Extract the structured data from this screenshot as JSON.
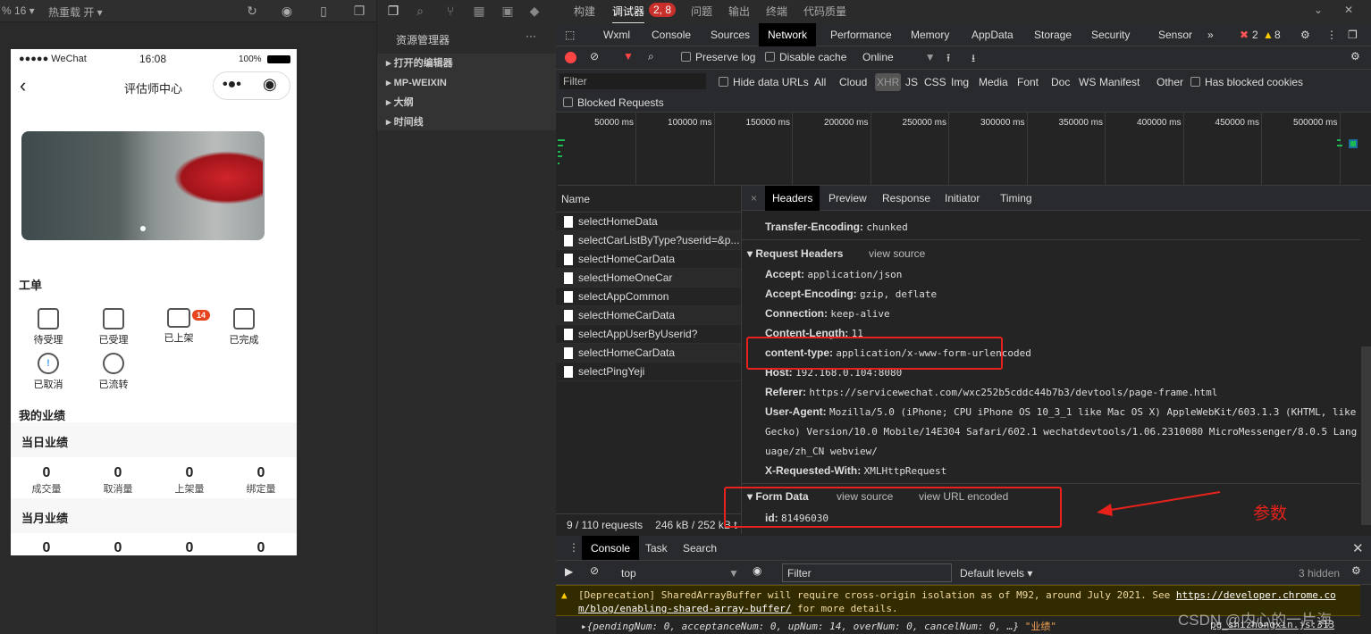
{
  "simulator": {
    "zoom": "% 16 ▾",
    "hot_reload": "热重载 开 ▾"
  },
  "phone": {
    "status": {
      "carrier": "●●●●● WeChat",
      "time": "16:08",
      "battery": "100%"
    },
    "nav_title": "评估师中心",
    "capsule_more": "•●•",
    "capsule_close": "◉",
    "orders_title": "工单",
    "orders": [
      {
        "label": "待受理"
      },
      {
        "label": "已受理"
      },
      {
        "label": "已上架",
        "badge": "14"
      },
      {
        "label": "已完成"
      },
      {
        "label": "已取消"
      },
      {
        "label": "已流转"
      }
    ],
    "perf_title": "我的业绩",
    "daily": {
      "title": "当日业绩",
      "stats": [
        {
          "value": "0",
          "label": "成交量"
        },
        {
          "value": "0",
          "label": "取消量"
        },
        {
          "value": "0",
          "label": "上架量"
        },
        {
          "value": "0",
          "label": "绑定量"
        }
      ]
    },
    "monthly": {
      "title": "当月业绩",
      "stats": [
        {
          "value": "0"
        },
        {
          "value": "0"
        },
        {
          "value": "0"
        },
        {
          "value": "0"
        }
      ]
    }
  },
  "explorer": {
    "title": "资源管理器",
    "more": "···",
    "items": [
      "打开的编辑器",
      "MP-WEIXIN",
      "大纲",
      "时间线"
    ]
  },
  "top_tabs": {
    "items": [
      "构建",
      "调试器",
      "问题",
      "输出",
      "终端",
      "代码质量"
    ],
    "badge": "2, 8",
    "active": "调试器"
  },
  "devtools": {
    "tabs": [
      "Wxml",
      "Console",
      "Sources",
      "Network",
      "Performance",
      "Memory",
      "AppData",
      "Storage",
      "Security",
      "Sensor"
    ],
    "active_tab": "Network",
    "more": "»",
    "errors": "2",
    "warnings": "8",
    "toolbar": {
      "preserve_log": "Preserve log",
      "disable_cache": "Disable cache",
      "throttle": "Online"
    },
    "filter": {
      "placeholder": "Filter",
      "hide_data_urls": "Hide data URLs",
      "types": [
        "All",
        "Cloud",
        "XHR",
        "JS",
        "CSS",
        "Img",
        "Media",
        "Font",
        "Doc",
        "WS",
        "Manifest",
        "Other"
      ],
      "active_type": "XHR",
      "blocked_cookies": "Has blocked cookies",
      "blocked_requests": "Blocked Requests"
    },
    "timeline_ticks": [
      "50000 ms",
      "100000 ms",
      "150000 ms",
      "200000 ms",
      "250000 ms",
      "300000 ms",
      "350000 ms",
      "400000 ms",
      "450000 ms",
      "500000 ms"
    ],
    "list": {
      "header": "Name",
      "items": [
        "selectHomeData",
        "selectCarListByType?userid=&p...",
        "selectHomeCarData",
        "selectHomeOneCar",
        "selectAppCommon",
        "selectHomeCarData",
        "selectAppUserByUserid?userid=...",
        "selectHomeCarData",
        "selectPingYeji"
      ],
      "summary": "9 / 110 requests",
      "size": "246 kB / 252 kB t"
    },
    "detail_tabs": [
      "Headers",
      "Preview",
      "Response",
      "Initiator",
      "Timing"
    ],
    "active_detail": "Headers",
    "response_headers": [
      {
        "k": "Transfer-Encoding:",
        "v": "chunked"
      }
    ],
    "request_headers_title": "Request Headers",
    "view_source": "view source",
    "request_headers": [
      {
        "k": "Accept:",
        "v": "application/json"
      },
      {
        "k": "Accept-Encoding:",
        "v": "gzip, deflate"
      },
      {
        "k": "Connection:",
        "v": "keep-alive"
      },
      {
        "k": "Content-Length:",
        "v": "11"
      },
      {
        "k": "content-type:",
        "v": "application/x-www-form-urlencoded"
      },
      {
        "k": "Host:",
        "v": "192.168.0.104:8080"
      },
      {
        "k": "Referer:",
        "v": "https://servicewechat.com/wxc252b5cddc44b7b3/devtools/page-frame.html"
      },
      {
        "k": "User-Agent:",
        "v": "Mozilla/5.0 (iPhone; CPU iPhone OS 10_3_1 like Mac OS X) AppleWebKit/603.1.3 (KHTML, like"
      },
      {
        "k": "",
        "v": "Gecko) Version/10.0 Mobile/14E304 Safari/602.1 wechatdevtools/1.06.2310080 MicroMessenger/8.0.5 Lang"
      },
      {
        "k": "",
        "v": "uage/zh_CN webview/"
      },
      {
        "k": "X-Requested-With:",
        "v": "XMLHttpRequest"
      }
    ],
    "form_data_title": "Form Data",
    "view_url_encoded": "view URL encoded",
    "form_data": [
      {
        "k": "id:",
        "v": "81496030"
      }
    ],
    "annotation": "参数",
    "drawer_tabs": [
      "Console",
      "Task",
      "Search"
    ],
    "console": {
      "context": "top",
      "filter_placeholder": "Filter",
      "levels": "Default levels ▾",
      "hidden": "3 hidden",
      "warning": "[Deprecation] SharedArrayBuffer will require cross-origin isolation as of M92, around July 2021. See ",
      "warning_link": "https://developer.chrome.com/blog/enabling-shared-array-buffer/",
      "warning_link_1": "https://developer.chrome.co",
      "warning_link_2": "m/blog/enabling-shared-array-buffer/",
      "warning_tail": " for more details.",
      "log": "{pendingNum: 0, acceptanceNum: 0, upNum: 14, overNum: 0, cancelNum: 0, …}",
      "log_str": "\"业绩\"",
      "log_source": "pg_shizhongxin.js:313"
    }
  },
  "watermark": "CSDN @内心的一片海",
  "colors": {
    "accent_red": "#e8221b",
    "badge": "#e8441e",
    "icon_blue": "#4a9ff5"
  }
}
